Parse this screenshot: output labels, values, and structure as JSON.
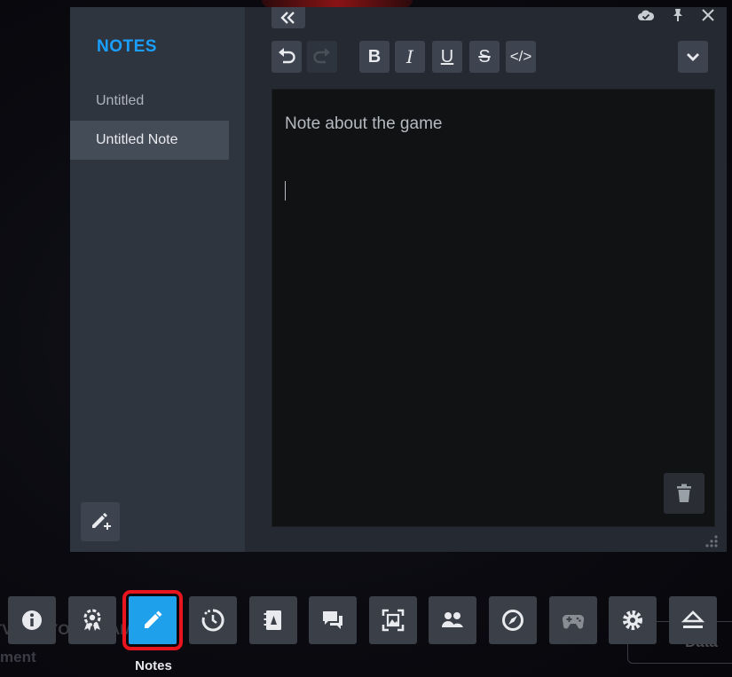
{
  "background": {
    "game_text_line1": "TV TOKYO,MONAM",
    "game_text_line2": "ment",
    "data_label": "Data"
  },
  "notes_panel": {
    "title": "NOTES",
    "notes": [
      {
        "label": "Untitled",
        "active": false
      },
      {
        "label": "Untitled Note",
        "active": true
      }
    ],
    "editor": {
      "content": "Note about the game"
    },
    "toolbar": {
      "undo": "undo-icon",
      "redo": "redo-icon",
      "bold": "B",
      "italic": "I",
      "underline": "U",
      "strikethrough": "S",
      "code": "</>"
    }
  },
  "quick_access_bar": {
    "active_label": "Notes",
    "items": [
      {
        "name": "info-icon"
      },
      {
        "name": "achievements-icon"
      },
      {
        "name": "notes-icon"
      },
      {
        "name": "timer-icon"
      },
      {
        "name": "guides-icon"
      },
      {
        "name": "chat-icon"
      },
      {
        "name": "screenshot-icon"
      },
      {
        "name": "friends-icon"
      },
      {
        "name": "compass-icon"
      },
      {
        "name": "controller-icon"
      },
      {
        "name": "settings-icon"
      },
      {
        "name": "eject-icon"
      }
    ]
  },
  "colors": {
    "accent": "#1a9fff",
    "active_highlight": "#e8141e",
    "active_button": "#1ea0ea"
  }
}
